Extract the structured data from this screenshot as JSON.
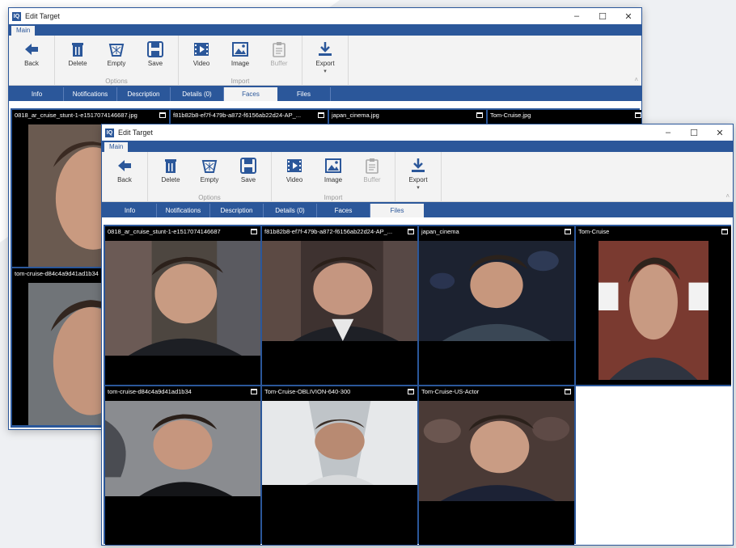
{
  "window": {
    "icon_text": "IQ",
    "title": "Edit Target",
    "minimize": "–",
    "maximize": "☐",
    "close": "✕"
  },
  "ribbon": {
    "tab_main": "Main",
    "buttons": {
      "back": "Back",
      "delete": "Delete",
      "empty": "Empty",
      "save": "Save",
      "video": "Video",
      "image": "Image",
      "buffer": "Buffer",
      "export": "Export"
    },
    "groups": {
      "options": "Options",
      "import": "Import"
    },
    "export_chevron": "▾",
    "collapse": "˄"
  },
  "tabs": [
    "Info",
    "Notifications",
    "Description",
    "Details (0)",
    "Faces",
    "Files"
  ],
  "back_window": {
    "active_tab": "Faces",
    "files": [
      "0818_ar_cruise_stunt-1-e1517074146687.jpg",
      "f81b82b8-ef7f-479b-a872-f6156ab22d24-AP_...",
      "japan_cinema.jpg",
      "Tom-Cruise.jpg",
      "tom-cruise-d84c4a9d41ad1b34"
    ]
  },
  "front_window": {
    "active_tab": "Files",
    "files": [
      "0818_ar_cruise_stunt-1-e1517074146687",
      "f81b82b8-ef7f-479b-a872-f6156ab22d24-AP_...",
      "japan_cinema",
      "Tom-Cruise",
      "tom-cruise-d84c4a9d41ad1b34",
      "Tom-Cruise-OBLIVION-640-300",
      "Tom-Cruise-US-Actor"
    ]
  },
  "colors": {
    "accent": "#2b579a",
    "ribbon_bg": "#f3f3f3",
    "cell_bg": "#000000"
  },
  "icons": [
    "back-arrow-icon",
    "trash-icon",
    "empty-bin-icon",
    "save-disk-icon",
    "video-film-icon",
    "image-icon",
    "buffer-clipboard-icon",
    "export-download-icon",
    "maximize-icon"
  ]
}
